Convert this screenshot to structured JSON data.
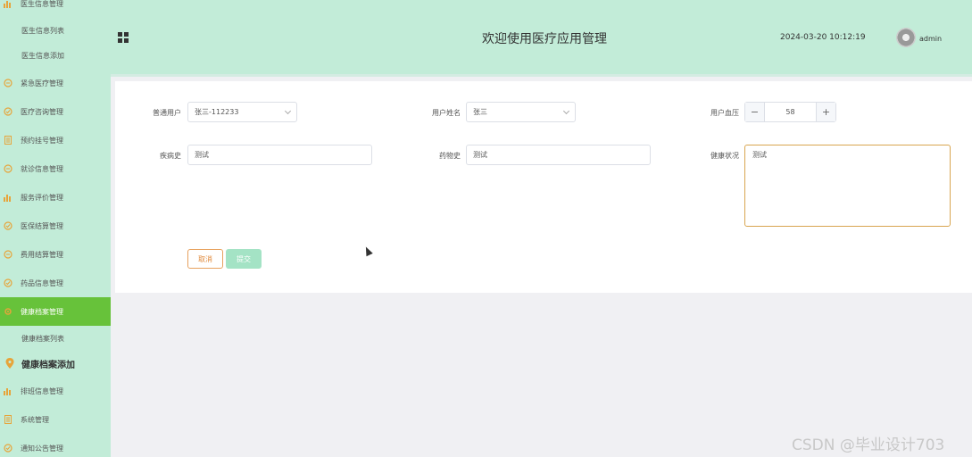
{
  "sidebar": {
    "items": [
      {
        "label": "医生信息管理",
        "icon": "chart-bar-icon"
      },
      {
        "label": "医生信息列表",
        "sub": true
      },
      {
        "label": "医生信息添加",
        "sub": true
      },
      {
        "label": "紧急医疗管理",
        "icon": "chat-icon"
      },
      {
        "label": "医疗咨询管理",
        "icon": "check-circle-icon"
      },
      {
        "label": "预约挂号管理",
        "icon": "document-icon"
      },
      {
        "label": "就诊信息管理",
        "icon": "chat-icon"
      },
      {
        "label": "服务评价管理",
        "icon": "chart-bar-icon"
      },
      {
        "label": "医保结算管理",
        "icon": "check-circle-icon"
      },
      {
        "label": "费用结算管理",
        "icon": "chat-icon"
      },
      {
        "label": "药品信息管理",
        "icon": "check-circle-icon"
      },
      {
        "label": "健康档案管理",
        "icon": "gear-icon",
        "active": true
      },
      {
        "label": "健康档案列表",
        "sub": true
      },
      {
        "label": "健康档案添加",
        "icon": "location-pin-icon",
        "big": true
      },
      {
        "label": "排班信息管理",
        "icon": "chart-bar-icon"
      },
      {
        "label": "系统管理",
        "icon": "document-icon"
      },
      {
        "label": "通知公告管理",
        "icon": "check-circle-icon"
      }
    ]
  },
  "header": {
    "title": "欢迎使用医疗应用管理",
    "datetime": "2024-03-20 10:12:19",
    "username": "admin"
  },
  "form": {
    "user_label": "普通用户",
    "user_value": "张三-112233",
    "name_label": "用户姓名",
    "name_value": "张三",
    "bp_label": "用户血压",
    "bp_value": "58",
    "bp_minus": "−",
    "bp_plus": "+",
    "disease_label": "疾病史",
    "disease_value": "测试",
    "drug_label": "药物史",
    "drug_value": "测试",
    "health_label": "健康状况",
    "health_value": "测试",
    "cancel_label": "取消",
    "submit_label": "提交"
  },
  "watermark": "CSDN @毕业设计703",
  "colors": {
    "header_bg": "#c2ecd8",
    "active_menu": "#67c23a",
    "icon_accent": "#e7a43a",
    "submit_bg": "#a4e3c5",
    "cancel_border": "#e7a15e"
  }
}
